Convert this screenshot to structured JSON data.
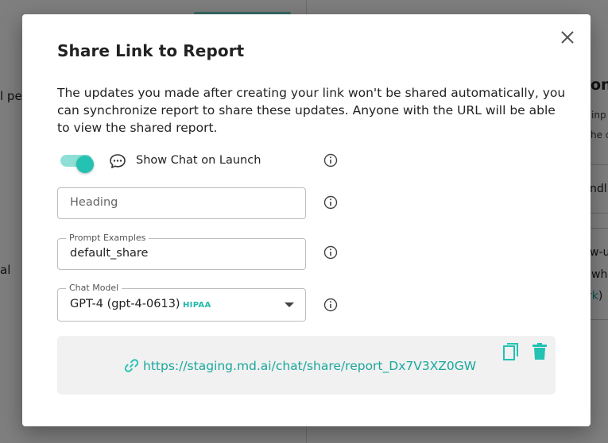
{
  "background": {
    "left_fragment_1": "l pel",
    "left_fragment_2": "al",
    "right_fragment_title": "on",
    "right_fragment_small_1": "inp",
    "right_fragment_small_2": "he c",
    "right_card_1_text": "ndl",
    "right_card_2_line_1": "w-u",
    "right_card_2_line_2": "wh",
    "right_card_2_line_3_link": "rk",
    "right_card_2_line_3_tail": ")"
  },
  "modal": {
    "title": "Share Link to Report",
    "description": "The updates you made after creating your link won't be shared automatically, you can synchronize report to share these updates. Anyone with the URL will be able to view the shared report.",
    "close_icon": "close-icon",
    "show_chat": {
      "label": "Show Chat on Launch",
      "enabled": true,
      "icon": "chat-bubble-icon"
    },
    "heading_field": {
      "placeholder": "Heading",
      "value": ""
    },
    "prompt_examples_field": {
      "label": "Prompt Examples",
      "value": "default_share"
    },
    "chat_model_field": {
      "label": "Chat Model",
      "value": "GPT-4 (gpt-4-0613)",
      "badge": "HIPAA"
    },
    "share_link": {
      "url": "https://staging.md.ai/chat/share/report_Dx7V3XZ0GW",
      "link_icon": "link-icon",
      "copy_icon": "copy-icon",
      "delete_icon": "trash-icon"
    }
  },
  "colors": {
    "accent": "#23c2b3",
    "accent_light": "#8ee0d6",
    "link": "#1aa79c",
    "share_box_bg": "#f1f1f1"
  }
}
